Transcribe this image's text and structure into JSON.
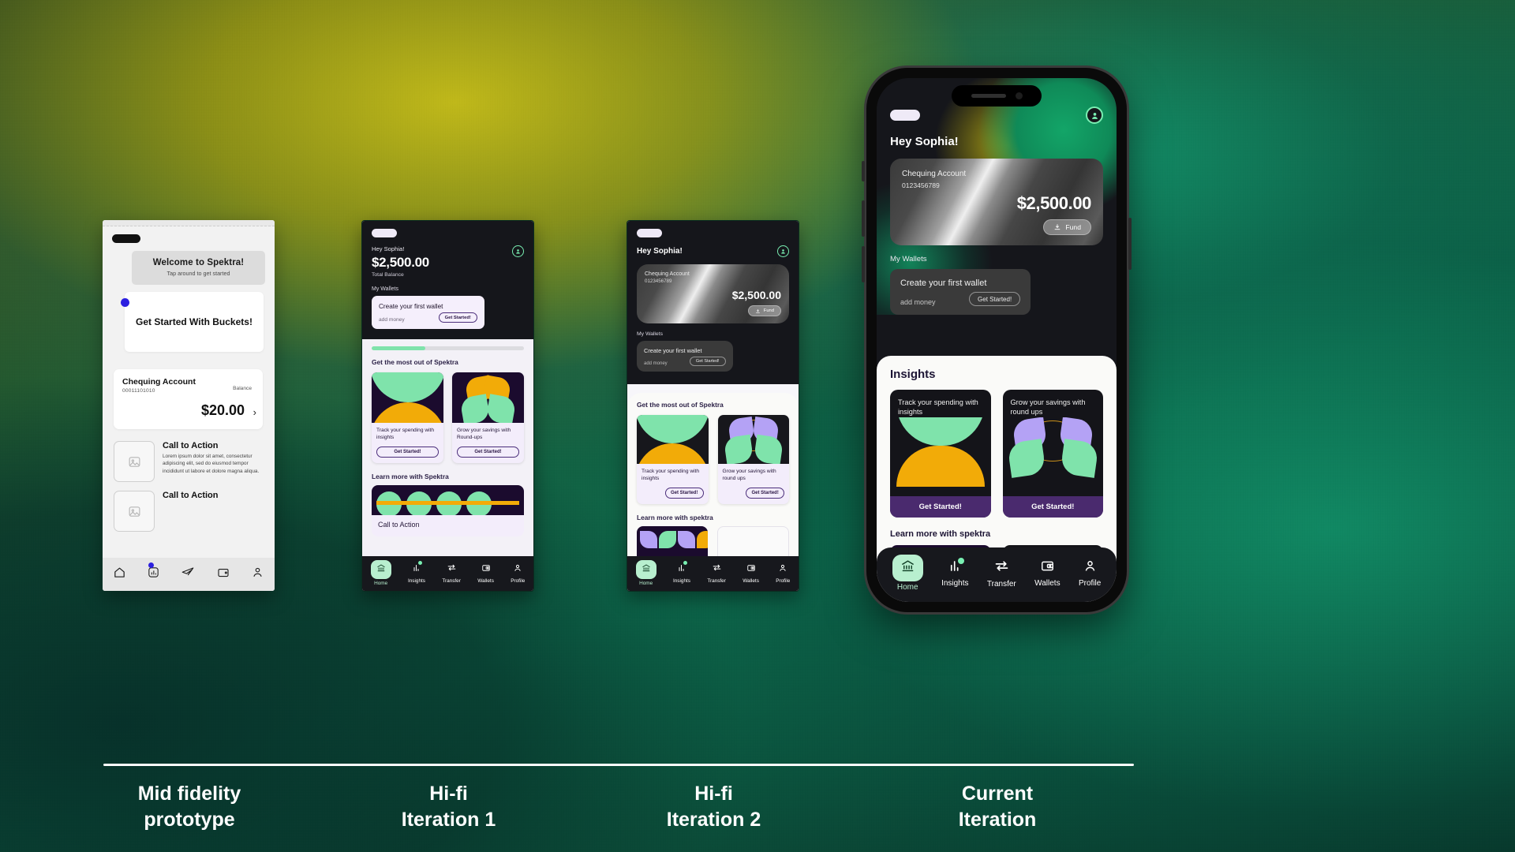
{
  "background": {
    "accent_green": "#13a568",
    "accent_yellow": "#c8be19",
    "dark": "#15161b"
  },
  "captions": [
    {
      "line1": "Mid fidelity",
      "line2": "prototype"
    },
    {
      "line1": "Hi-fi",
      "line2": "Iteration 1"
    },
    {
      "line1": "Hi-fi",
      "line2": "Iteration 2"
    },
    {
      "line1": "Current",
      "line2": "Iteration"
    }
  ],
  "phone1": {
    "tooltip": {
      "title": "Welcome to Spektra!",
      "subtitle": "Tap around to get started"
    },
    "bucket_card": "Get Started With Buckets!",
    "account": {
      "name": "Chequing Account",
      "number": "00011101010",
      "balance_label": "Balance",
      "amount": "$20.00",
      "chevron": "›"
    },
    "cta_blocks": [
      {
        "title": "Call to Action",
        "body": "Lorem ipsum dolor sit amet, consectetur adipiscing elit, sed do eiusmod tempor incididunt ut labore et dolore magna aliqua."
      },
      {
        "title": "Call to Action",
        "body": ""
      }
    ],
    "nav": [
      {
        "name": "home-icon",
        "badge": false
      },
      {
        "name": "insights-icon",
        "badge": true
      },
      {
        "name": "transfer-icon",
        "badge": false
      },
      {
        "name": "wallets-icon",
        "badge": false
      },
      {
        "name": "profile-icon",
        "badge": false
      }
    ]
  },
  "phone2": {
    "greeting": "Hey Sophia!",
    "amount": "$2,500.00",
    "amount_label": "Total Balance",
    "wallets_heading": "My Wallets",
    "wallet": {
      "title": "Create your first wallet",
      "subtitle": "add money",
      "button": "Get Started!"
    },
    "progress_percent": 35,
    "section_title": "Get the most out of Spektra",
    "features": [
      {
        "title": "Track your spending with insights",
        "button": "Get Started!",
        "art": "bowl-dome"
      },
      {
        "title": "Grow your savings with Round-ups",
        "button": "Get Started!",
        "art": "leaf-yellow"
      }
    ],
    "learn_title": "Learn more with Spektra",
    "learn_card": "Call to Action",
    "nav": [
      {
        "label": "Home",
        "icon": "bank-icon",
        "active": true,
        "badge": false
      },
      {
        "label": "Insights",
        "icon": "bar-chart-icon",
        "active": false,
        "badge": true
      },
      {
        "label": "Transfer",
        "icon": "transfer-arrows-icon",
        "active": false,
        "badge": false
      },
      {
        "label": "Wallets",
        "icon": "wallet-icon",
        "active": false,
        "badge": false
      },
      {
        "label": "Profile",
        "icon": "person-icon",
        "active": false,
        "badge": false
      }
    ]
  },
  "phone3": {
    "greeting": "Hey Sophia!",
    "card": {
      "name": "Chequing Account",
      "number": "0123456789",
      "amount": "$2,500.00",
      "fund_button": "Fund"
    },
    "wallets_heading": "My Wallets",
    "wallet": {
      "title": "Create your first wallet",
      "subtitle": "add money",
      "button": "Get Started!"
    },
    "section_title": "Get the most out of Spektra",
    "features": [
      {
        "title": "Track your spending with insights",
        "button": "Get Started!",
        "art": "bowl-dome"
      },
      {
        "title": "Grow your savings with round ups",
        "button": "Get Started!",
        "art": "leaf-purple"
      }
    ],
    "learn_title": "Learn more with spektra",
    "nav": [
      {
        "label": "Home",
        "icon": "bank-icon",
        "active": true,
        "badge": false
      },
      {
        "label": "Insights",
        "icon": "bar-chart-icon",
        "active": false,
        "badge": true
      },
      {
        "label": "Transfer",
        "icon": "transfer-arrows-icon",
        "active": false,
        "badge": false
      },
      {
        "label": "Wallets",
        "icon": "wallet-icon",
        "active": false,
        "badge": false
      },
      {
        "label": "Profile",
        "icon": "person-icon",
        "active": false,
        "badge": false
      }
    ]
  },
  "phone4": {
    "greeting": "Hey Sophia!",
    "card": {
      "name": "Chequing Account",
      "number": "0123456789",
      "amount": "$2,500.00",
      "fund_button": "Fund"
    },
    "wallets_heading": "My Wallets",
    "wallet": {
      "title": "Create your first wallet",
      "subtitle": "add money",
      "button": "Get Started!"
    },
    "insights_title": "Insights",
    "features": [
      {
        "title": "Track your spending with insights",
        "button": "Get Started!",
        "art": "bowl-dome"
      },
      {
        "title": "Grow your savings with round ups",
        "button": "Get Started!",
        "art": "leaf-purple"
      }
    ],
    "learn_title": "Learn more with spektra",
    "nav": [
      {
        "label": "Home",
        "icon": "bank-icon",
        "active": true,
        "badge": false
      },
      {
        "label": "Insights",
        "icon": "bar-chart-icon",
        "active": false,
        "badge": true
      },
      {
        "label": "Transfer",
        "icon": "transfer-arrows-icon",
        "active": false,
        "badge": false
      },
      {
        "label": "Wallets",
        "icon": "wallet-icon",
        "active": false,
        "badge": false
      },
      {
        "label": "Profile",
        "icon": "person-icon",
        "active": false,
        "badge": false
      }
    ]
  }
}
